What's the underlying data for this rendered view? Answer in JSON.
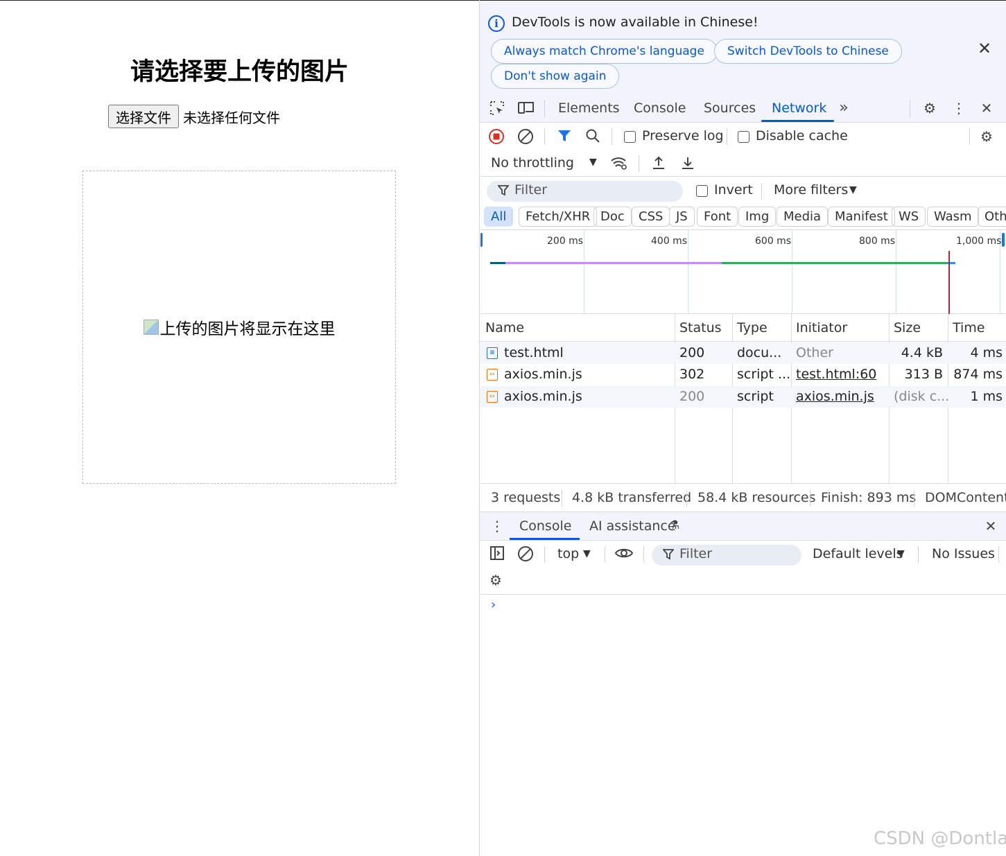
{
  "page": {
    "title": "请选择要上传的图片",
    "file_button": "选择文件",
    "file_status": "未选择任何文件",
    "preview_alt": "上传的图片将显示在这里"
  },
  "infobar": {
    "message": "DevTools is now available in Chinese!",
    "btn_match": "Always match Chrome's language",
    "btn_switch": "Switch DevTools to Chinese",
    "btn_dont_show": "Don't show again"
  },
  "tabs": [
    "Elements",
    "Console",
    "Sources",
    "Network"
  ],
  "active_tab": "Network",
  "toolbar": {
    "preserve_log": "Preserve log",
    "disable_cache": "Disable cache",
    "throttling": "No throttling",
    "filter_placeholder": "Filter",
    "invert": "Invert",
    "more_filters": "More filters"
  },
  "type_filters": [
    "All",
    "Fetch/XHR",
    "Doc",
    "CSS",
    "JS",
    "Font",
    "Img",
    "Media",
    "Manifest",
    "WS",
    "Wasm",
    "Othe"
  ],
  "timeline_ticks": [
    "200 ms",
    "400 ms",
    "600 ms",
    "800 ms",
    "1,000 ms"
  ],
  "columns": [
    "Name",
    "Status",
    "Type",
    "Initiator",
    "Size",
    "Time"
  ],
  "requests": [
    {
      "name": "test.html",
      "status": "200",
      "type": "docu...",
      "initiator": "Other",
      "size": "4.4 kB",
      "time": "4 ms",
      "kind": "doc"
    },
    {
      "name": "axios.min.js",
      "status": "302",
      "type": "script ...",
      "initiator": "test.html:60",
      "size": "313 B",
      "time": "874 ms",
      "kind": "script"
    },
    {
      "name": "axios.min.js",
      "status": "200",
      "type": "script",
      "initiator": "axios.min.js",
      "size": "(disk c...",
      "time": "1 ms",
      "kind": "script"
    }
  ],
  "summary": {
    "requests": "3 requests",
    "transferred": "4.8 kB transferred",
    "resources": "58.4 kB resources",
    "finish": "Finish: 893 ms",
    "domcontent": "DOMContent"
  },
  "drawer": {
    "tab_console": "Console",
    "tab_ai": "AI assistance",
    "context": "top",
    "filter_placeholder": "Filter",
    "levels": "Default levels",
    "issues": "No Issues"
  },
  "watermark": "CSDN @Dontla",
  "colors": {
    "accent": "#0b57d0",
    "record": "#d93025",
    "script_icon": "#e8710a",
    "doc_icon": "#1a73e8"
  }
}
